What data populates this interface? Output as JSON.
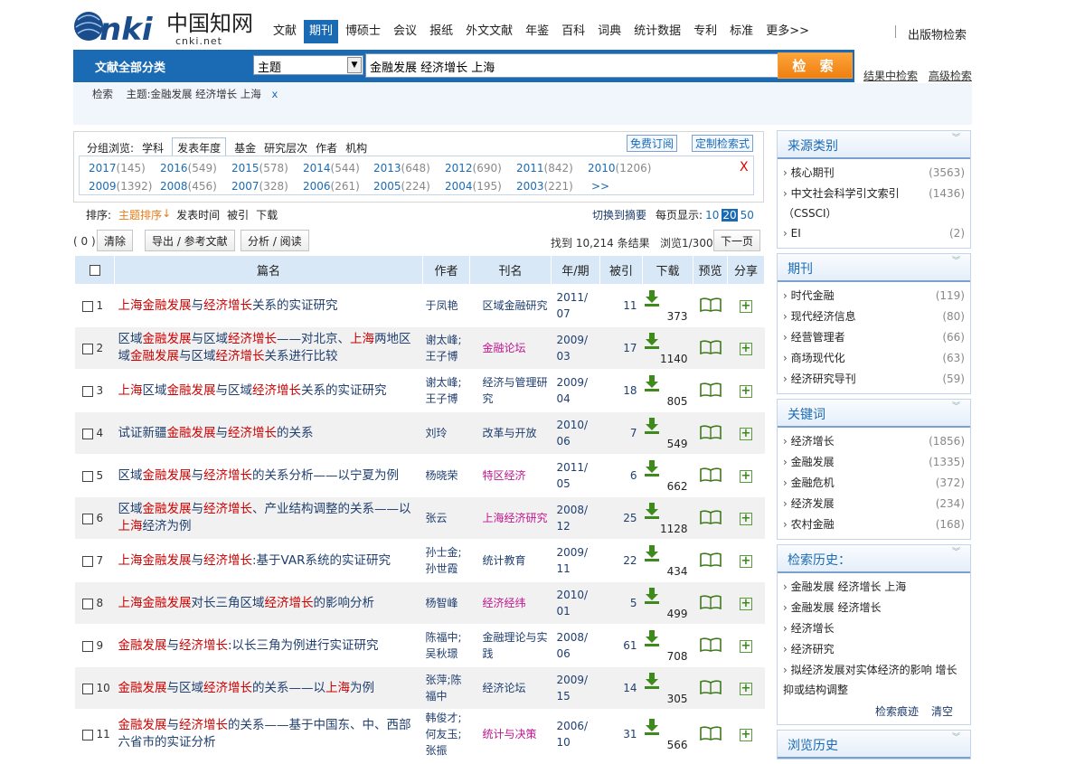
{
  "logo": {
    "text": "CNKi中国知网",
    "sub": "cnki.net"
  },
  "nav": {
    "items": [
      "文献",
      "期刊",
      "博硕士",
      "会议",
      "报纸",
      "外文文献",
      "年鉴",
      "百科",
      "词典",
      "统计数据",
      "专利",
      "标准",
      "更多>>"
    ],
    "active_index": 1,
    "right_link": "出版物检索"
  },
  "search": {
    "category_label": "文献全部分类",
    "field": "主题",
    "query": "金融发展 经济增长 上海",
    "button": "检 索",
    "links": [
      "结果中检索",
      "高级检索"
    ]
  },
  "breadcrumb": {
    "label": "检索",
    "criteria": "主题:金融发展 经济增长 上海",
    "close": "x"
  },
  "filter": {
    "label": "分组浏览:",
    "tabs": [
      "学科",
      "发表年度",
      "基金",
      "研究层次",
      "作者",
      "机构"
    ],
    "selected_tab": 1,
    "buttons": [
      "免费订阅",
      "定制检索式"
    ],
    "years_row1": [
      [
        "2017",
        "(145)"
      ],
      [
        "2016",
        "(549)"
      ],
      [
        "2015",
        "(578)"
      ],
      [
        "2014",
        "(544)"
      ],
      [
        "2013",
        "(648)"
      ],
      [
        "2012",
        "(690)"
      ],
      [
        "2011",
        "(842)"
      ],
      [
        "2010",
        "(1206)"
      ]
    ],
    "years_row2": [
      [
        "2009",
        "(1392)"
      ],
      [
        "2008",
        "(456)"
      ],
      [
        "2007",
        "(328)"
      ],
      [
        "2006",
        "(261)"
      ],
      [
        "2005",
        "(224)"
      ],
      [
        "2004",
        "(195)"
      ],
      [
        "2003",
        "(221)"
      ],
      [
        ">>",
        ""
      ]
    ],
    "close": "X"
  },
  "sort": {
    "label": "排序:",
    "options": [
      "主题排序",
      "发表时间",
      "被引",
      "下载"
    ],
    "active": "主题排序",
    "switch": "切换到摘要",
    "per_page_label": "每页显示:",
    "per_page": [
      "10",
      "20",
      "50"
    ],
    "per_page_selected": "20"
  },
  "actions": {
    "count": "( 0 )",
    "clear": "清除",
    "export": "导出 / 参考文献",
    "analyze": "分析 / 阅读",
    "found": "找到 10,214 条结果",
    "browse": "浏览1/300",
    "next": "下一页"
  },
  "table": {
    "headers": [
      "篇名",
      "作者",
      "刊名",
      "年/期",
      "被引",
      "下载",
      "预览",
      "分享"
    ],
    "rows": [
      {
        "n": "1",
        "title": [
          [
            "上海金融发展",
            1
          ],
          [
            "与",
            0
          ],
          [
            "经济增长",
            1
          ],
          [
            "关系的实证研究",
            0
          ]
        ],
        "author": "于凤艳",
        "journal": "区域金融研究",
        "jm": false,
        "date": "2011/07",
        "cited": "11",
        "dl": "373"
      },
      {
        "n": "2",
        "title": [
          [
            "区域",
            0
          ],
          [
            "金融发展",
            1
          ],
          [
            "与区域",
            0
          ],
          [
            "经济增长",
            1
          ],
          [
            "——对北京、",
            0
          ],
          [
            "上海",
            1
          ],
          [
            "两地区域",
            0
          ],
          [
            "金融发展",
            1
          ],
          [
            "与区域",
            0
          ],
          [
            "经济增长",
            1
          ],
          [
            "关系进行比较",
            0
          ]
        ],
        "author": "谢太峰;王子博",
        "journal": "金融论坛",
        "jm": true,
        "date": "2009/03",
        "cited": "17",
        "dl": "1140"
      },
      {
        "n": "3",
        "title": [
          [
            "上海",
            1
          ],
          [
            "区域",
            0
          ],
          [
            "金融发展",
            1
          ],
          [
            "与区域",
            0
          ],
          [
            "经济增长",
            1
          ],
          [
            "关系的实证研究",
            0
          ]
        ],
        "author": "谢太峰;王子博",
        "journal": "经济与管理研究",
        "jm": false,
        "date": "2009/04",
        "cited": "18",
        "dl": "805"
      },
      {
        "n": "4",
        "title": [
          [
            "试证新疆",
            0
          ],
          [
            "金融发展",
            1
          ],
          [
            "与",
            0
          ],
          [
            "经济增长",
            1
          ],
          [
            "的关系",
            0
          ]
        ],
        "author": "刘玲",
        "journal": "改革与开放",
        "jm": false,
        "date": "2010/06",
        "cited": "7",
        "dl": "549"
      },
      {
        "n": "5",
        "title": [
          [
            "区域",
            0
          ],
          [
            "金融发展",
            1
          ],
          [
            "与",
            0
          ],
          [
            "经济增长",
            1
          ],
          [
            "的关系分析——以宁夏为例",
            0
          ]
        ],
        "author": "杨晓荣",
        "journal": "特区经济",
        "jm": true,
        "date": "2011/05",
        "cited": "6",
        "dl": "662"
      },
      {
        "n": "6",
        "title": [
          [
            "区域",
            0
          ],
          [
            "金融发展",
            1
          ],
          [
            "与",
            0
          ],
          [
            "经济增长",
            1
          ],
          [
            "、产业结构调整的关系——以",
            0
          ],
          [
            "上海",
            1
          ],
          [
            "经济",
            0
          ],
          [
            "为例",
            0
          ]
        ],
        "author": "张云",
        "journal": "上海经济研究",
        "jm": true,
        "date": "2008/12",
        "cited": "25",
        "dl": "1128"
      },
      {
        "n": "7",
        "title": [
          [
            "上海金融发展",
            1
          ],
          [
            "与",
            0
          ],
          [
            "经济增长",
            1
          ],
          [
            ":基于VAR系统的实证研究",
            0
          ]
        ],
        "author": "孙士金;孙世霞",
        "journal": "统计教育",
        "jm": false,
        "date": "2009/11",
        "cited": "22",
        "dl": "434"
      },
      {
        "n": "8",
        "title": [
          [
            "上海金融发展",
            1
          ],
          [
            "对长三角区域",
            0
          ],
          [
            "经济增长",
            1
          ],
          [
            "的影响分析",
            0
          ]
        ],
        "author": "杨智峰",
        "journal": "经济经纬",
        "jm": true,
        "date": "2010/01",
        "cited": "5",
        "dl": "499"
      },
      {
        "n": "9",
        "title": [
          [
            "金融发展",
            1
          ],
          [
            "与",
            0
          ],
          [
            "经济增长",
            1
          ],
          [
            ":以长三角为例进行实证研究",
            0
          ]
        ],
        "author": "陈福中;吴秋璟",
        "journal": "金融理论与实践",
        "jm": false,
        "date": "2008/06",
        "cited": "61",
        "dl": "708"
      },
      {
        "n": "10",
        "title": [
          [
            "金融发展",
            1
          ],
          [
            "与区域",
            0
          ],
          [
            "经济增长",
            1
          ],
          [
            "的关系——以",
            0
          ],
          [
            "上海",
            1
          ],
          [
            "为例",
            0
          ]
        ],
        "author": "张萍;陈福中",
        "journal": "经济论坛",
        "jm": false,
        "date": "2009/15",
        "cited": "14",
        "dl": "305"
      },
      {
        "n": "11",
        "title": [
          [
            "金融发展",
            1
          ],
          [
            "与",
            0
          ],
          [
            "经济增长",
            1
          ],
          [
            "的关系——基于中国东、中、西部六省市的实证分析",
            0
          ]
        ],
        "author": "韩俊才;何友玉;张振",
        "journal": "统计与决策",
        "jm": true,
        "date": "2006/10",
        "cited": "31",
        "dl": "566"
      }
    ]
  },
  "sidebar": {
    "source": {
      "title": "来源类别",
      "items": [
        [
          "核心期刊",
          "(3563)"
        ],
        [
          "中文社会科学引文索引（CSSCI）",
          "(1436)"
        ],
        [
          "EI",
          "(2)"
        ]
      ]
    },
    "journal": {
      "title": "期刊",
      "items": [
        [
          "时代金融",
          "(119)"
        ],
        [
          "现代经济信息",
          "(80)"
        ],
        [
          "经营管理者",
          "(66)"
        ],
        [
          "商场现代化",
          "(63)"
        ],
        [
          "经济研究导刊",
          "(59)"
        ]
      ]
    },
    "keyword": {
      "title": "关键词",
      "items": [
        [
          "经济增长",
          "(1856)"
        ],
        [
          "金融发展",
          "(1335)"
        ],
        [
          "金融危机",
          "(372)"
        ],
        [
          "经济发展",
          "(234)"
        ],
        [
          "农村金融",
          "(168)"
        ]
      ]
    },
    "history": {
      "title": "检索历史：",
      "items": [
        "金融发展 经济增长 上海",
        "金融发展 经济增长",
        "经济增长",
        "经济研究",
        "拟经济发展对实体经济的影响 增长抑或结构调整"
      ],
      "trace": "检索痕迹",
      "clear": "清空"
    },
    "browse": {
      "title": "浏览历史"
    }
  }
}
